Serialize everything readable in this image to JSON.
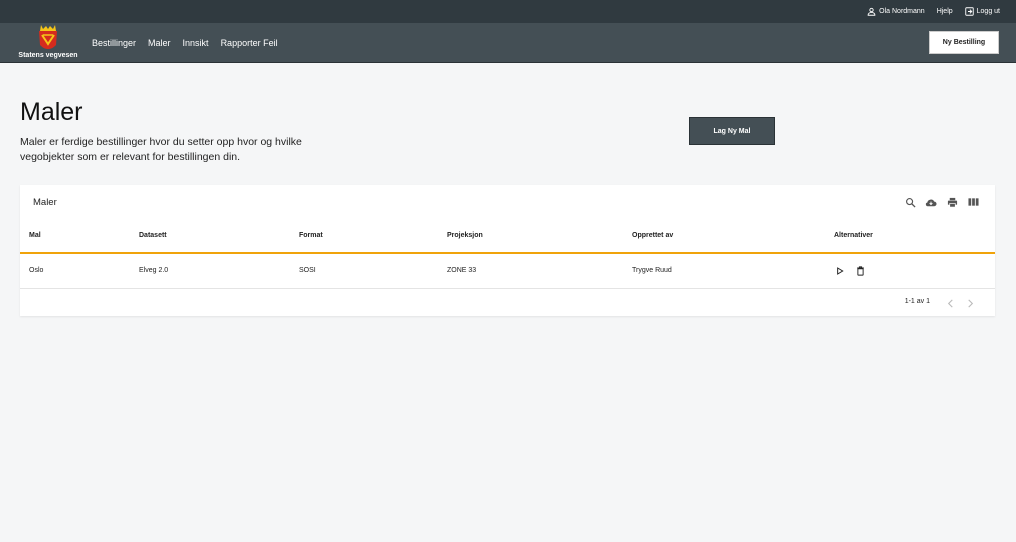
{
  "topbar": {
    "user_label": "Ola Nordmann",
    "help_label": "Hjelp",
    "logout_label": "Logg ut",
    "user_icon": "person-icon",
    "logout_icon": "logout-icon"
  },
  "navbar": {
    "logo_text": "Statens vegvesen",
    "items": [
      {
        "label": "Bestillinger"
      },
      {
        "label": "Maler"
      },
      {
        "label": "Innsikt"
      },
      {
        "label": "Rapporter Feil"
      }
    ],
    "new_order_label": "Ny Bestilling"
  },
  "header": {
    "title": "Maler",
    "description": "Maler er ferdige bestillinger hvor du setter opp hvor og hvilke vegobjekter som er relevant for bestillingen din.",
    "create_button_label": "Lag Ny Mal"
  },
  "table": {
    "title": "Maler",
    "toolbar_icons": [
      "search-icon",
      "cloud-download-icon",
      "print-icon",
      "columns-icon"
    ],
    "columns": [
      "Mal",
      "Datasett",
      "Format",
      "Projeksjon",
      "Opprettet av",
      "Alternativer"
    ],
    "rows": [
      {
        "mal": "Oslo",
        "datasett": "Elveg 2.0",
        "format": "SOSI",
        "projeksjon": "ZONE 33",
        "opprettet_av": "Trygve Ruud"
      }
    ],
    "pagination_text": "1-1 av 1"
  },
  "colors": {
    "topbar": "#303a40",
    "navbar": "#444f55",
    "accent": "#f0a30a",
    "background": "#f5f6f7"
  }
}
